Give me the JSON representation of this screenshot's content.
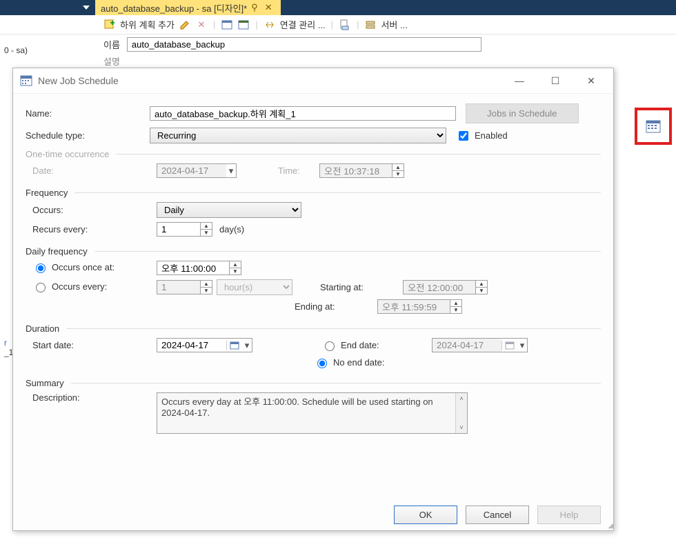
{
  "main_tab": {
    "title": "auto_database_backup - sa [디자인]*"
  },
  "toolbar": {
    "add_sub": "하위 계획 추가",
    "conn": "연결 관리 ...",
    "server": "서버 ..."
  },
  "nameline": {
    "label": "이름",
    "value": "auto_database_backup",
    "label2": "설명"
  },
  "leftfrag": {
    "line1": "0 - sa)",
    "line2": "r",
    "line3": "_1"
  },
  "dialog": {
    "title": "New Job Schedule",
    "name_label": "Name:",
    "name_value": "auto_database_backup.하위 계획_1",
    "jobs_btn": "Jobs in Schedule",
    "type_label": "Schedule type:",
    "type_value": "Recurring",
    "enabled": "Enabled",
    "onetime": {
      "head": "One-time occurrence",
      "date_label": "Date:",
      "date_value": "2024-04-17",
      "time_label": "Time:",
      "time_value": "오전 10:37:18"
    },
    "freq": {
      "head": "Frequency",
      "occurs_label": "Occurs:",
      "occurs_value": "Daily",
      "recurs_label": "Recurs every:",
      "recurs_value": "1",
      "recurs_unit": "day(s)"
    },
    "daily": {
      "head": "Daily frequency",
      "once_label": "Occurs once at:",
      "once_value": "오후 11:00:00",
      "every_label": "Occurs every:",
      "every_value": "1",
      "every_unit": "hour(s)",
      "starting_label": "Starting at:",
      "starting_value": "오전 12:00:00",
      "ending_label": "Ending at:",
      "ending_value": "오후 11:59:59"
    },
    "duration": {
      "head": "Duration",
      "start_label": "Start date:",
      "start_value": "2024-04-17",
      "end_label": "End date:",
      "end_value": "2024-04-17",
      "noend_label": "No end date:"
    },
    "summary": {
      "head": "Summary",
      "desc_label": "Description:",
      "desc_value": "Occurs every day at 오후 11:00:00. Schedule will be used starting on 2024-04-17."
    },
    "buttons": {
      "ok": "OK",
      "cancel": "Cancel",
      "help": "Help"
    }
  }
}
